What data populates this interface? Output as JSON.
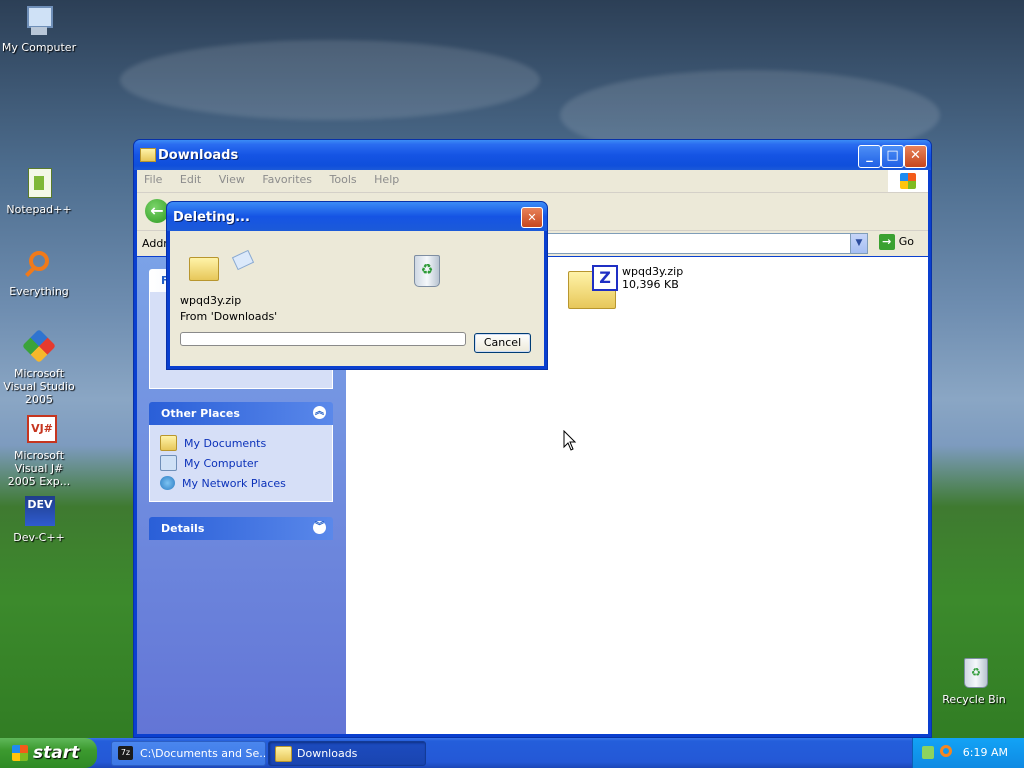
{
  "desktop": {
    "icons": [
      {
        "label": "My Computer",
        "icon": "computer-icon"
      },
      {
        "label": "Notepad++",
        "icon": "notepadpp-icon"
      },
      {
        "label": "Everything",
        "icon": "everything-icon"
      },
      {
        "label": "Microsoft Visual Studio 2005",
        "icon": "visual-studio-icon"
      },
      {
        "label": "Microsoft Visual J# 2005 Exp...",
        "icon": "vjsharp-icon"
      },
      {
        "label": "Dev-C++",
        "icon": "devcpp-icon"
      },
      {
        "label": "Recycle Bin",
        "icon": "recycle-bin-icon"
      }
    ]
  },
  "window": {
    "title": "Downloads",
    "menu": [
      "File",
      "Edit",
      "View",
      "Favorites",
      "Tools",
      "Help"
    ],
    "address_label": "Addre",
    "go_label": "Go",
    "task_pane": {
      "other_places_title": "Other Places",
      "other_places": [
        "My Documents",
        "My Computer",
        "My Network Places"
      ],
      "details_title": "Details",
      "collapsed_first_letter": "F"
    },
    "file": {
      "name": "wpqd3y.zip",
      "size": "10,396 KB"
    }
  },
  "dialog": {
    "title": "Deleting...",
    "file_name": "wpqd3y.zip",
    "from_text": "From 'Downloads'",
    "progress_percent": 0,
    "cancel_label": "Cancel"
  },
  "taskbar": {
    "start_label": "start",
    "buttons": [
      {
        "label": "C:\\Documents and Se...",
        "icon": "7zip-icon",
        "active": false
      },
      {
        "label": "Downloads",
        "icon": "folder-icon",
        "active": true
      }
    ],
    "clock": "6:19 AM"
  },
  "colors": {
    "xp_blue": "#0a3fcf",
    "taskbar_blue": "#245edb",
    "start_green": "#3c9a2f",
    "link_blue": "#0c32b9"
  }
}
